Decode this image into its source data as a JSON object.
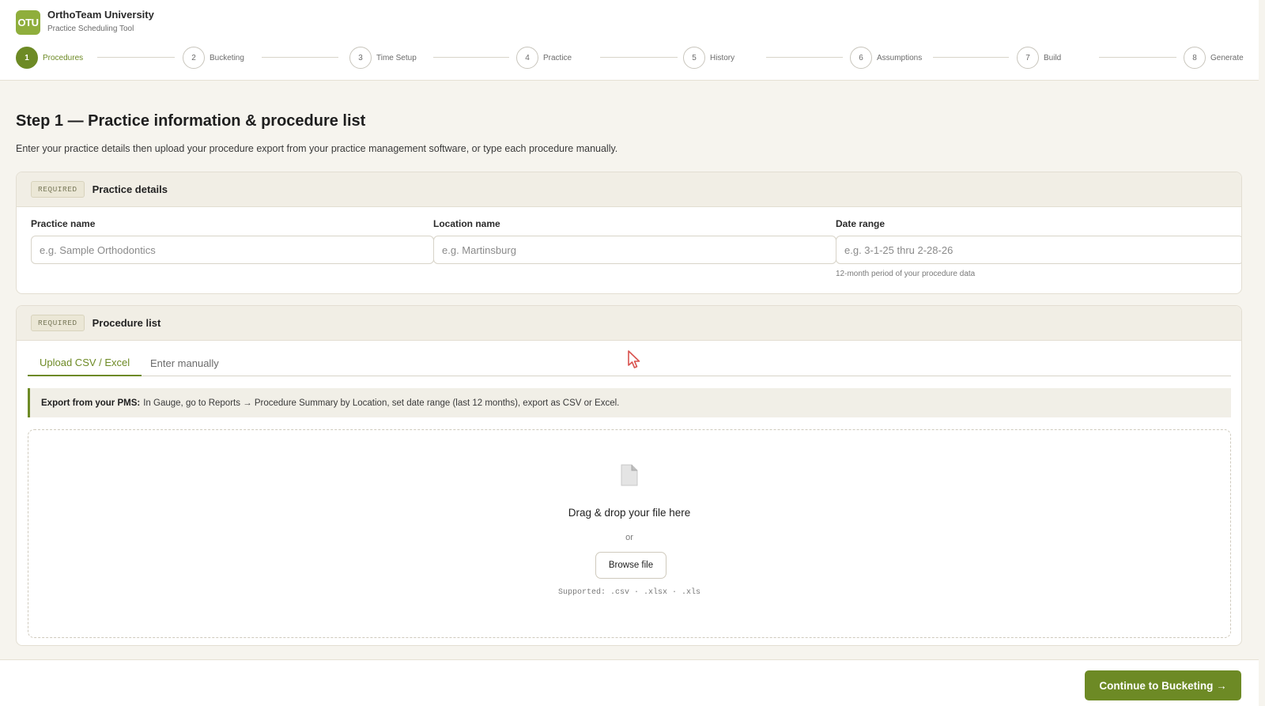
{
  "app": {
    "logo_text": "OTU",
    "title": "OrthoTeam University",
    "subtitle": "Practice Scheduling Tool",
    "accent_color": "#6d8a25"
  },
  "steps": [
    {
      "number": "1",
      "label": "Procedures",
      "active": true
    },
    {
      "number": "2",
      "label": "Bucketing",
      "active": false
    },
    {
      "number": "3",
      "label": "Time Setup",
      "active": false
    },
    {
      "number": "4",
      "label": "Practice",
      "active": false
    },
    {
      "number": "5",
      "label": "History",
      "active": false
    },
    {
      "number": "6",
      "label": "Assumptions",
      "active": false
    },
    {
      "number": "7",
      "label": "Build",
      "active": false
    },
    {
      "number": "8",
      "label": "Generate",
      "active": false
    }
  ],
  "page": {
    "title": "Step 1 — Practice information & procedure list",
    "description": "Enter your practice details then upload your procedure export from your practice management software, or type each procedure manually."
  },
  "practice_details": {
    "badge": "REQUIRED",
    "title": "Practice details",
    "fields": [
      {
        "label": "Practice name",
        "placeholder": "e.g. Sample Orthodontics",
        "value": "",
        "hint": ""
      },
      {
        "label": "Location name",
        "placeholder": "e.g. Martinsburg",
        "value": "",
        "hint": ""
      },
      {
        "label": "Date range",
        "placeholder": "e.g. 3-1-25 thru 2-28-26",
        "value": "",
        "hint": "12-month period of your procedure data"
      }
    ]
  },
  "procedure_list": {
    "badge": "REQUIRED",
    "title": "Procedure list",
    "tabs": [
      {
        "label": "Upload CSV / Excel",
        "active": true
      },
      {
        "label": "Enter manually",
        "active": false
      }
    ],
    "info_bold": "Export from your PMS:",
    "info_text": "In Gauge, go to Reports → Procedure Summary by Location, set date range (last 12 months), export as CSV or Excel.",
    "dropzone": {
      "icon": "file-icon",
      "title": "Drag & drop your file here",
      "or": "or",
      "browse_label": "Browse file",
      "supported": "Supported: .csv · .xlsx · .xls"
    }
  },
  "footer": {
    "continue_label": "Continue to Bucketing →"
  }
}
